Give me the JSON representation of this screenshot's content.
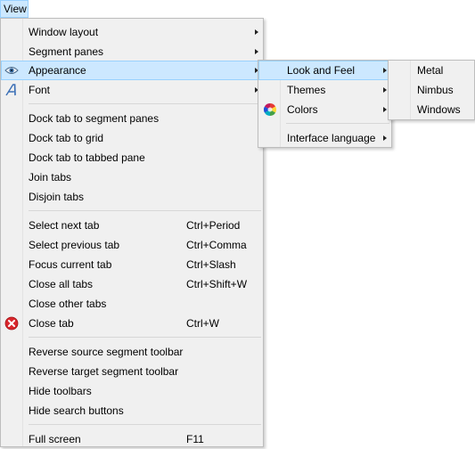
{
  "menubar": {
    "view": "View"
  },
  "view_menu": {
    "window_layout": "Window layout",
    "segment_panes": "Segment panes",
    "appearance": "Appearance",
    "font": "Font",
    "dock_segment": "Dock tab to segment panes",
    "dock_grid": "Dock tab to grid",
    "dock_tabbed": "Dock tab to tabbed pane",
    "join_tabs": "Join tabs",
    "disjoin_tabs": "Disjoin tabs",
    "select_next": "Select next tab",
    "select_next_key": "Ctrl+Period",
    "select_prev": "Select previous tab",
    "select_prev_key": "Ctrl+Comma",
    "focus_current": "Focus current tab",
    "focus_current_key": "Ctrl+Slash",
    "close_all": "Close all tabs",
    "close_all_key": "Ctrl+Shift+W",
    "close_other": "Close other tabs",
    "close_tab": "Close tab",
    "close_tab_key": "Ctrl+W",
    "rev_source": "Reverse source segment toolbar",
    "rev_target": "Reverse target segment toolbar",
    "hide_toolbars": "Hide toolbars",
    "hide_search": "Hide search buttons",
    "full_screen": "Full screen",
    "full_screen_key": "F11"
  },
  "appearance_menu": {
    "look_and_feel": "Look and Feel",
    "themes": "Themes",
    "colors": "Colors",
    "interface_language": "Interface language"
  },
  "laf_menu": {
    "metal": "Metal",
    "nimbus": "Nimbus",
    "windows": "Windows"
  },
  "icons": {
    "appearance": "eye-icon",
    "font": "font-icon",
    "close_tab": "close-red-icon",
    "colors": "color-wheel-icon"
  },
  "colors": {
    "selection_bg": "#cce8ff",
    "selection_border": "#99d1ff",
    "menu_bg": "#f0f0f0"
  }
}
